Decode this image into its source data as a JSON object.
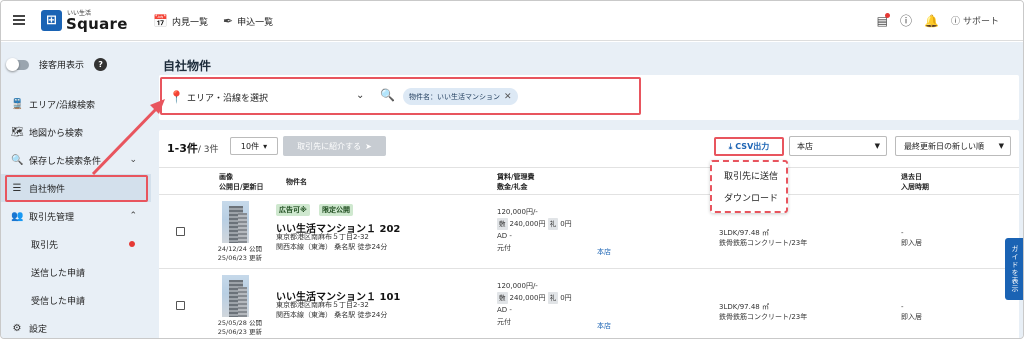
{
  "header": {
    "logo_letter": "■",
    "logo_sub": "いい生活",
    "logo_main": "Square",
    "nav_viewing": "内見一覧",
    "nav_apply": "申込一覧",
    "support": "サポート"
  },
  "sidebar": {
    "customer_view": "接客用表示",
    "items": [
      {
        "label": "エリア/沿線検索"
      },
      {
        "label": "地図から検索"
      },
      {
        "label": "保存した検索条件"
      },
      {
        "label": "自社物件"
      },
      {
        "label": "取引先管理"
      },
      {
        "label": "取引先"
      },
      {
        "label": "送信した申請"
      },
      {
        "label": "受信した申請"
      },
      {
        "label": "設定"
      }
    ]
  },
  "main": {
    "page_title": "自社物件",
    "area_select": "エリア・沿線を選択",
    "chip": "物件名：いい生活マンション",
    "count_main": "1-3件",
    "count_sub": "/ 3件",
    "per_page": "10件",
    "intro_button": "取引先に紹介する",
    "csv_button": "CSV出力",
    "store_select": "本店",
    "sort_select": "最終更新日の新しい順",
    "dropdown": [
      "取引先に送信",
      "ダウンロード"
    ],
    "columns": {
      "image": "画像",
      "image_sub": "公開日/更新日",
      "name": "物件名",
      "rent": "賃料/管理費",
      "rent_sub": "敷金/礼金",
      "vacancy": "退去日",
      "vacancy_sub": "入居時期"
    },
    "rows": [
      {
        "tags": [
          "広告可※",
          "限定公開"
        ],
        "name": "いい生活マンション１ 202",
        "address": "東京都港区南麻布５丁目2-32",
        "station": "関西本線（東海） 桑名駅 徒歩24分",
        "published": "24/12/24 公開",
        "updated": "25/06/23 更新",
        "rent": "120,000円/-",
        "deposit_label": "敷",
        "deposit": "240,000円",
        "key_label": "礼",
        "key": "0円",
        "ad": "AD -",
        "payment": "元付",
        "store": "本店",
        "layout": "3LDK/97.48 ㎡",
        "structure": "鉄骨鉄筋コンクリート/23年",
        "vacate": "-",
        "move_in": "即入居"
      },
      {
        "tags": [],
        "name": "いい生活マンション１ 101",
        "address": "東京都港区南麻布５丁目2-32",
        "station": "関西本線（東海） 桑名駅 徒歩24分",
        "published": "25/05/28 公開",
        "updated": "25/06/23 更新",
        "rent": "120,000円/-",
        "deposit_label": "敷",
        "deposit": "240,000円",
        "key_label": "礼",
        "key": "0円",
        "ad": "AD -",
        "payment": "元付",
        "store": "本店",
        "layout": "3LDK/97.48 ㎡",
        "structure": "鉄骨鉄筋コンクリート/23年",
        "vacate": "-",
        "move_in": "即入居"
      }
    ],
    "guide_tab": "ガイドを表示"
  },
  "colors": {
    "brand": "#1a63b4",
    "highlight": "#e8555e",
    "sidebar_bg": "#e8eff6"
  }
}
